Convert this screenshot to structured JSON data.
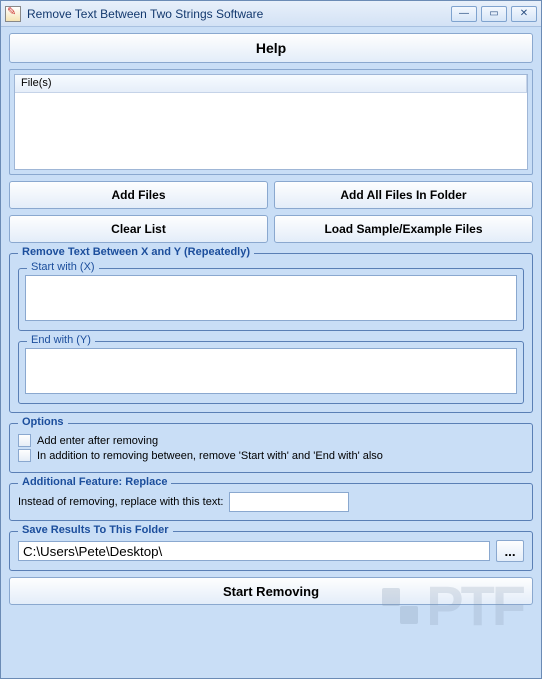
{
  "window": {
    "title": "Remove Text Between Two Strings Software"
  },
  "help_label": "Help",
  "files": {
    "header": "File(s)"
  },
  "buttons": {
    "add_files": "Add Files",
    "add_all": "Add All Files In Folder",
    "clear_list": "Clear List",
    "load_sample": "Load Sample/Example Files",
    "start": "Start Removing",
    "browse": "..."
  },
  "remove_group": {
    "title": "Remove Text Between X and Y (Repeatedly)",
    "start_label": "Start with (X)",
    "end_label": "End with (Y)",
    "start_value": "",
    "end_value": ""
  },
  "options": {
    "title": "Options",
    "opt1": "Add enter after removing",
    "opt2": "In addition to removing between, remove 'Start with' and 'End with' also"
  },
  "replace": {
    "title": "Additional Feature: Replace",
    "label": "Instead of removing, replace with this text:",
    "value": ""
  },
  "save": {
    "title": "Save Results To This Folder",
    "path": "C:\\Users\\Pete\\Desktop\\"
  },
  "watermark": "PTF"
}
